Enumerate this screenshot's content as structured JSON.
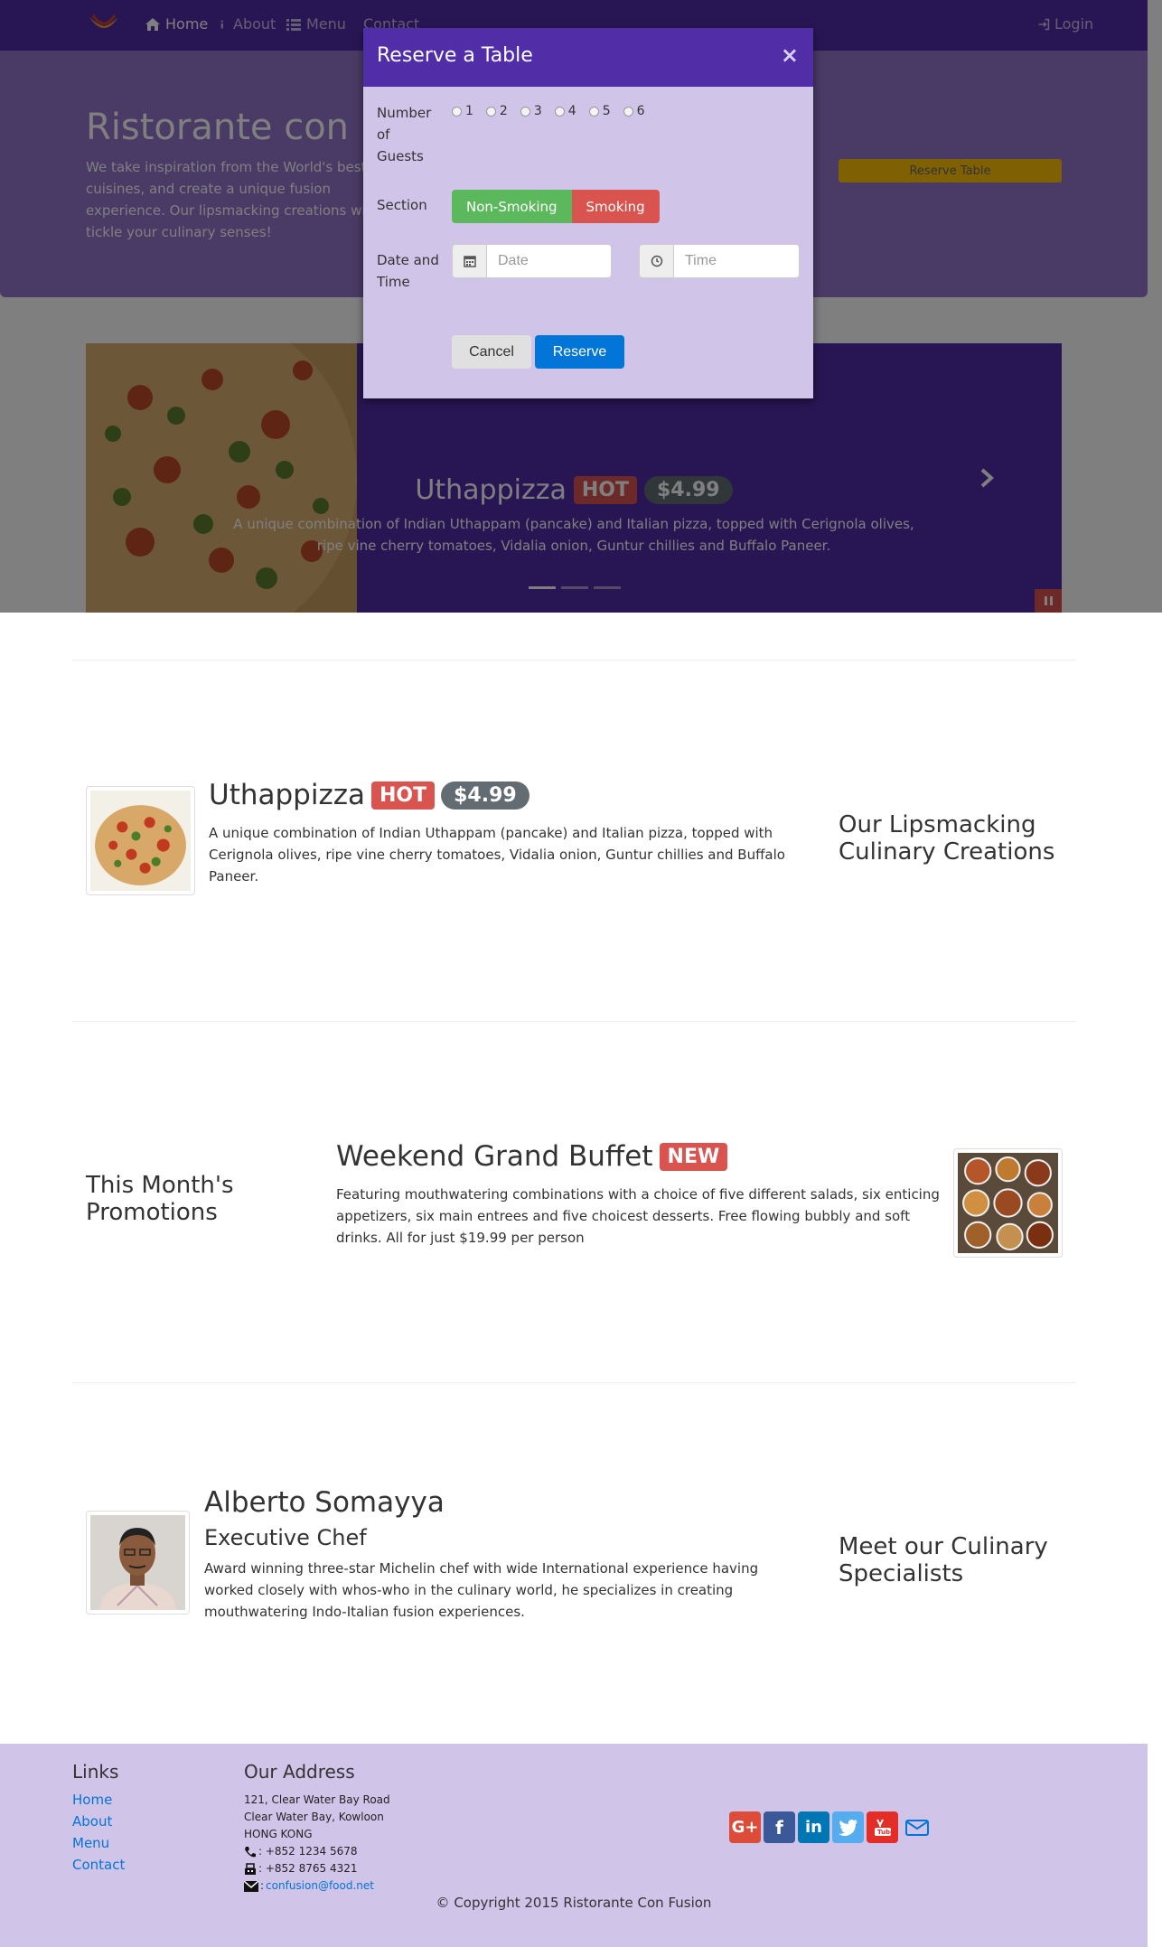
{
  "nav": {
    "home": "Home",
    "about": "About",
    "menu": "Menu",
    "contact": "Contact",
    "login": "Login"
  },
  "jumbotron": {
    "title": "Ristorante con Fusion",
    "text": "We take inspiration from the World's best cuisines, and create a unique fusion experience. Our lipsmacking creations will tickle your culinary senses!",
    "reserve_label": "Reserve Table"
  },
  "carousel": {
    "title": "Uthappizza",
    "badge": "HOT",
    "price": "$4.99",
    "description": "A unique combination of Indian Uthappam (pancake) and Italian pizza, topped with Cerignola olives, ripe vine cherry tomatoes, Vidalia onion, Guntur chillies and Buffalo Paneer."
  },
  "modal": {
    "title": "Reserve a Table",
    "close": "×",
    "guests_label": "Number of Guests",
    "guest_options": [
      "1",
      "2",
      "3",
      "4",
      "5",
      "6"
    ],
    "section_label": "Section",
    "non_smoking": "Non-Smoking",
    "smoking": "Smoking",
    "datetime_label": "Date and Time",
    "date_placeholder": "Date",
    "time_placeholder": "Time",
    "cancel": "Cancel",
    "reserve": "Reserve"
  },
  "dish": {
    "title": "Uthappizza",
    "badge": "HOT",
    "price": "$4.99",
    "description": "A unique combination of Indian Uthappam (pancake) and Italian pizza, topped with Cerignola olives, ripe vine cherry tomatoes, Vidalia onion, Guntur chillies and Buffalo Paneer.",
    "section_heading": "Our Lipsmacking Culinary Creations"
  },
  "promotion": {
    "section_heading": "This Month's Promotions",
    "title": "Weekend Grand Buffet",
    "badge": "NEW",
    "description": "Featuring mouthwatering combinations with a choice of five different salads, six enticing appetizers, six main entrees and five choicest desserts. Free flowing bubbly and soft drinks. All for just $19.99 per person"
  },
  "leader": {
    "name": "Alberto Somayya",
    "designation": "Executive Chef",
    "description": "Award winning three-star Michelin chef with wide International experience having worked closely with whos-who in the culinary world, he specializes in creating mouthwatering Indo-Italian fusion experiences.",
    "section_heading": "Meet our Culinary Specialists"
  },
  "footer": {
    "links_heading": "Links",
    "links": [
      "Home",
      "About",
      "Menu",
      "Contact"
    ],
    "address_heading": "Our Address",
    "address_lines": [
      "121, Clear Water Bay Road",
      "Clear Water Bay, Kowloon",
      "HONG KONG"
    ],
    "phone": ": +852 1234 5678",
    "fax": ": +852 8765 4321",
    "email": "confusion@food.net",
    "email_prefix": ":",
    "social": [
      "google-plus",
      "facebook",
      "linkedin",
      "twitter",
      "youtube",
      "mail"
    ],
    "copyright": "© Copyright 2015 Ristorante Con Fusion"
  }
}
